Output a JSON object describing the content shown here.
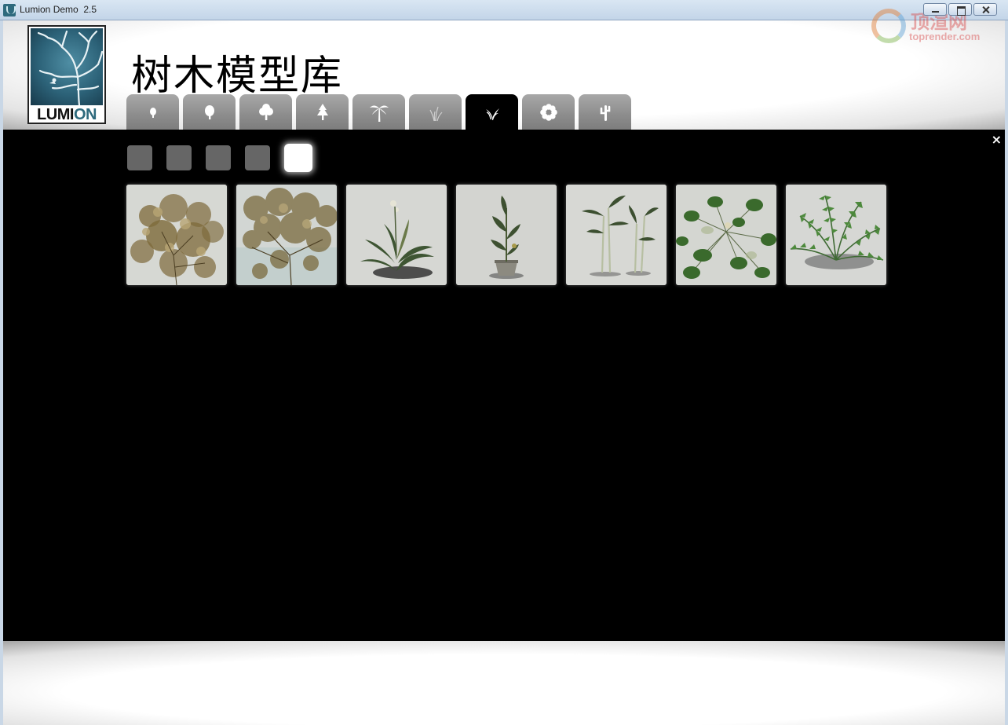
{
  "window": {
    "title": "Lumion Demo  2.5",
    "watermark_text": "顶渲网",
    "watermark_sub": "toprender.com"
  },
  "header": {
    "logo_text_a": "LUMI",
    "logo_text_b": "ON",
    "title": "树木模型库"
  },
  "tabs": [
    {
      "icon": "small-tree-icon",
      "active": false
    },
    {
      "icon": "deciduous-tree-icon",
      "active": false
    },
    {
      "icon": "broadleaf-tree-icon",
      "active": false
    },
    {
      "icon": "conifer-tree-icon",
      "active": false
    },
    {
      "icon": "palm-tree-icon",
      "active": false
    },
    {
      "icon": "grass-icon",
      "active": false
    },
    {
      "icon": "plant-icon",
      "active": true
    },
    {
      "icon": "flower-icon",
      "active": false
    },
    {
      "icon": "cactus-icon",
      "active": false
    }
  ],
  "main": {
    "close_label": "×",
    "subcategories": [
      {
        "active": false
      },
      {
        "active": false
      },
      {
        "active": false
      },
      {
        "active": false
      },
      {
        "active": true
      }
    ],
    "thumbnails": [
      {
        "name": "dry-shrub-thumbnail"
      },
      {
        "name": "sprawling-shrub-thumbnail"
      },
      {
        "name": "broadleaf-plant-thumbnail"
      },
      {
        "name": "potted-plant-thumbnail"
      },
      {
        "name": "tall-leaf-plants-thumbnail"
      },
      {
        "name": "round-leaf-plant-thumbnail"
      },
      {
        "name": "fern-thumbnail"
      }
    ]
  },
  "colors": {
    "active_tab": "#000000",
    "inactive_tab": "#8c8c8c",
    "logo_blue": "#2e6a7d"
  }
}
